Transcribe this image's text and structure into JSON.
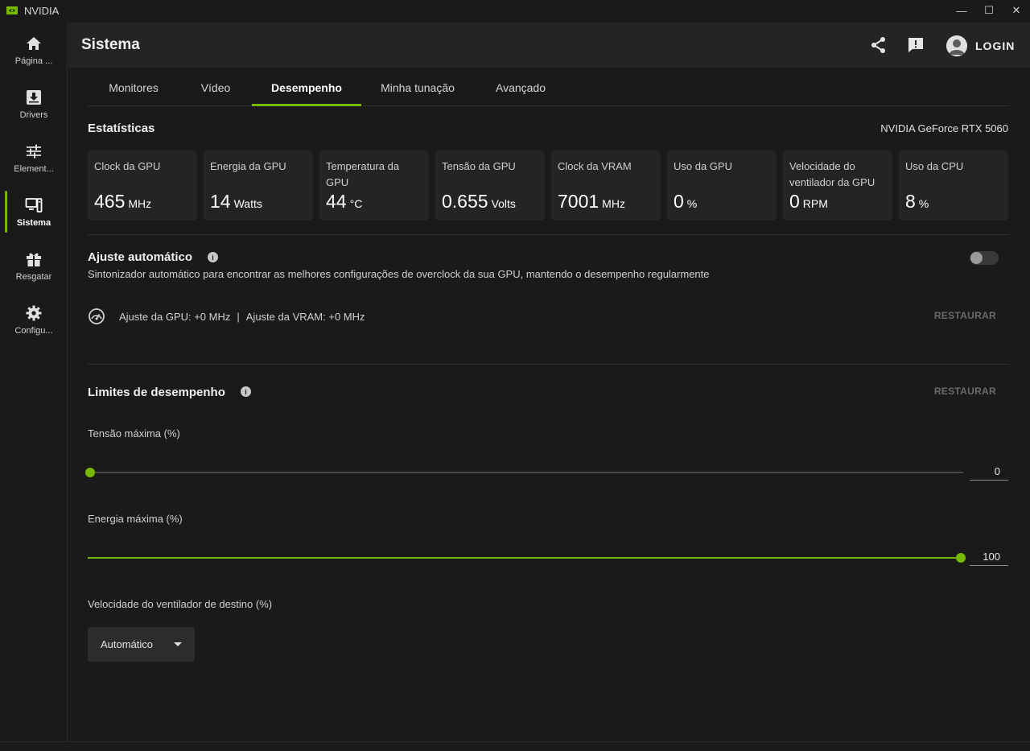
{
  "app": {
    "title": "NVIDIA"
  },
  "window_controls": {
    "minimize": "—",
    "maximize": "☐",
    "close": "✕"
  },
  "sidebar": {
    "items": [
      {
        "label": "Página ...",
        "icon": "home-icon"
      },
      {
        "label": "Drivers",
        "icon": "download-icon"
      },
      {
        "label": "Element...",
        "icon": "sliders-icon"
      },
      {
        "label": "Sistema",
        "icon": "system-icon",
        "active": true
      },
      {
        "label": "Resgatar",
        "icon": "gift-icon"
      },
      {
        "label": "Configu...",
        "icon": "gear-icon"
      }
    ]
  },
  "header": {
    "title": "Sistema",
    "login_label": "LOGIN"
  },
  "tabs": [
    {
      "label": "Monitores"
    },
    {
      "label": "Vídeo"
    },
    {
      "label": "Desempenho",
      "active": true
    },
    {
      "label": "Minha tunação"
    },
    {
      "label": "Avançado"
    }
  ],
  "stats": {
    "title": "Estatísticas",
    "gpu_name": "NVIDIA GeForce RTX 5060",
    "cards": [
      {
        "label": "Clock da GPU",
        "value": "465",
        "unit": "MHz"
      },
      {
        "label": "Energia da GPU",
        "value": "14",
        "unit": "Watts"
      },
      {
        "label": "Temperatura da GPU",
        "value": "44",
        "unit": "°C"
      },
      {
        "label": "Tensão da GPU",
        "value": "0.655",
        "unit": "Volts"
      },
      {
        "label": "Clock da VRAM",
        "value": "7001",
        "unit": "MHz"
      },
      {
        "label": "Uso da GPU",
        "value": "0",
        "unit": "%"
      },
      {
        "label": "Velocidade do ventilador da GPU",
        "value": "0",
        "unit": "RPM"
      },
      {
        "label": "Uso da CPU",
        "value": "8",
        "unit": "%"
      }
    ]
  },
  "auto_tune": {
    "title": "Ajuste automático",
    "description": "Sintonizador automático para encontrar as melhores configurações de overclock da sua GPU, mantendo o desempenho regularmente",
    "enabled": false,
    "gpu_adjust": "Ajuste da GPU: +0 MHz",
    "separator": "|",
    "vram_adjust": "Ajuste da VRAM: +0 MHz",
    "restore_label": "RESTAURAR"
  },
  "limits": {
    "title": "Limites de desempenho",
    "restore_label": "RESTAURAR",
    "max_voltage": {
      "label": "Tensão máxima (%)",
      "value": "0",
      "fraction": 0.0
    },
    "max_power": {
      "label": "Energia máxima (%)",
      "value": "100",
      "fraction": 1.0
    },
    "fan_target": {
      "label": "Velocidade do ventilador de destino (%)",
      "selected": "Automático"
    }
  },
  "colors": {
    "accent": "#76b900",
    "background": "#1a1a1a",
    "card": "#242424"
  }
}
